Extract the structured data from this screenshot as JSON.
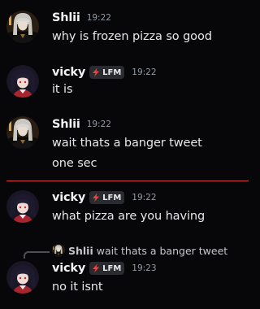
{
  "colors": {
    "background": "#070709",
    "new_messages_divider": "#d23c3c",
    "tag_bolt": "#e8453c"
  },
  "messages": [
    {
      "author": "Shlii",
      "timestamp": "19:22",
      "avatar": "shlii-avatar",
      "lines": [
        "why is frozen pizza so good"
      ]
    },
    {
      "author": "vicky",
      "tag": "LFM",
      "tag_icon": "bolt-icon",
      "timestamp": "19:22",
      "avatar": "vicky-avatar",
      "lines": [
        "it is"
      ]
    },
    {
      "author": "Shlii",
      "timestamp": "19:22",
      "avatar": "shlii-avatar",
      "lines": [
        "wait thats a banger tweet",
        "one sec"
      ]
    },
    {
      "author": "vicky",
      "tag": "LFM",
      "tag_icon": "bolt-icon",
      "timestamp": "19:22",
      "avatar": "vicky-avatar",
      "lines": [
        "what pizza are you having"
      ]
    },
    {
      "reply_to": {
        "author": "Shlii",
        "text": "wait thats a banger tweet"
      },
      "author": "vicky",
      "tag": "LFM",
      "tag_icon": "bolt-icon",
      "timestamp": "19:23",
      "avatar": "vicky-avatar",
      "lines": [
        "no it isnt"
      ]
    }
  ]
}
